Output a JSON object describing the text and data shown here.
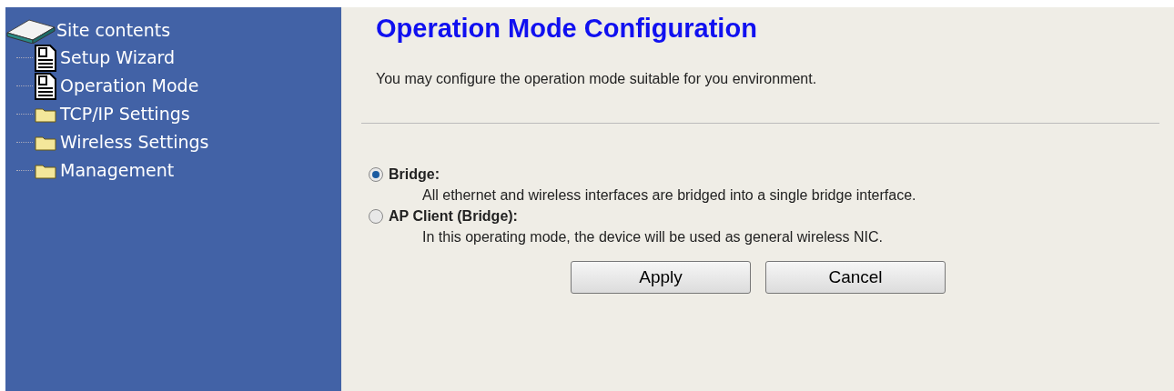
{
  "sidebar": {
    "title": "Site contents",
    "items": [
      {
        "label": "Setup Wizard",
        "kind": "page"
      },
      {
        "label": "Operation Mode",
        "kind": "page"
      },
      {
        "label": "TCP/IP Settings",
        "kind": "folder"
      },
      {
        "label": "Wireless Settings",
        "kind": "folder"
      },
      {
        "label": "Management",
        "kind": "folder"
      }
    ]
  },
  "main": {
    "title": "Operation Mode Configuration",
    "description": "You may configure the operation mode suitable for you environment.",
    "modes": [
      {
        "label": "Bridge:",
        "description": "All ethernet and wireless interfaces are bridged into a single bridge interface.",
        "selected": true
      },
      {
        "label": "AP Client (Bridge):",
        "description": "In this operating mode, the device will be used as general wireless NIC.",
        "selected": false
      }
    ],
    "buttons": [
      "Apply",
      "Cancel"
    ]
  }
}
